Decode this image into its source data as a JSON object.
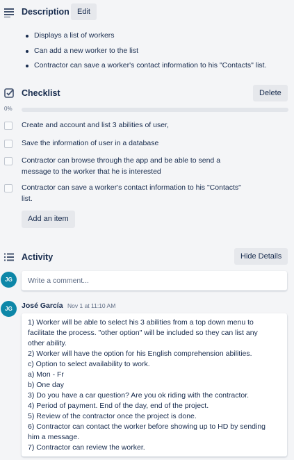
{
  "description": {
    "title": "Description",
    "edit_label": "Edit",
    "items": [
      "Displays a list of workers",
      "Can add a new worker to the list",
      "Contractor can save a worker's contact information to his \"Contacts\" list."
    ]
  },
  "checklist": {
    "title": "Checklist",
    "delete_label": "Delete",
    "progress_text": "0%",
    "progress_value": 0,
    "progress_color": "#5aac44",
    "items": [
      {
        "text": "Create and account and list 3 abilities of user,",
        "checked": false
      },
      {
        "text": "Save the information of user in a database",
        "checked": false
      },
      {
        "text": "Contractor can browse through the app and be able to send a message to the worker that he is interested",
        "checked": false
      },
      {
        "text": "Contractor can save a worker's contact information to his \"Contacts\" list.",
        "checked": false
      }
    ],
    "add_item_label": "Add an item"
  },
  "activity": {
    "title": "Activity",
    "hide_details_label": "Hide Details",
    "comment_placeholder": "Write a comment...",
    "avatar_initials": "JG",
    "avatar_color": "#0d87a8",
    "comment": {
      "author": "José García",
      "timestamp": "Nov 1 at 11:10 AM",
      "lines": [
        "1) Worker will be able to select his 3 abilities from a top down menu to",
        "facilitate the process. \"other option\" will be included so they can list any",
        "other ability.",
        "2) Worker will have the option for his English comprehension abilities.",
        "c) Option to select availability to work.",
        "a) Mon - Fr",
        "b) One day",
        "3) Do you have a car question? Are you ok riding with the contractor.",
        "4) Period of payment. End of the day, end of the project.",
        "5) Review of the contractor once the project is done.",
        "6) Contractor can contact the worker before showing up to HD by sending",
        "him a message.",
        "7) Contractor can review the worker."
      ]
    }
  }
}
